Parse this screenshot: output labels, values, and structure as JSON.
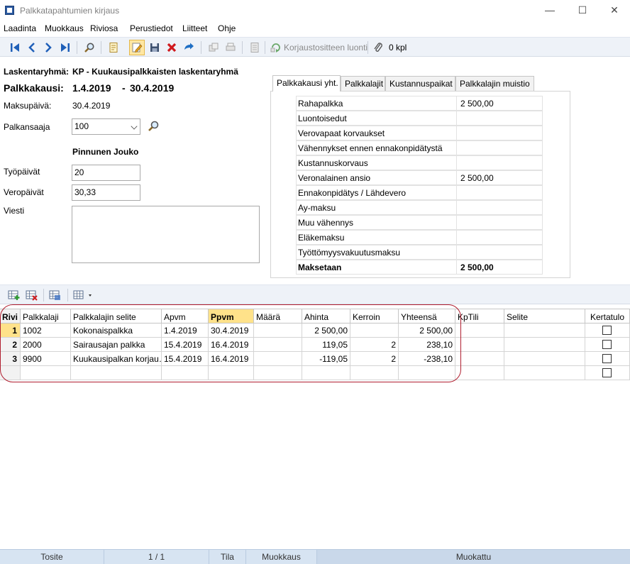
{
  "window": {
    "title": "Palkkatapahtumien kirjaus"
  },
  "menu": [
    "Laadinta",
    "Muokkaus",
    "Riviosa",
    "Perustiedot",
    "Liitteet",
    "Ohje"
  ],
  "toolbar": {
    "correction_label": "Korjaustositteen luonti",
    "count_label": "0 kpl"
  },
  "header": {
    "group_label": "Laskentaryhmä:",
    "group_value": "KP - Kuukausipalkkaisten laskentaryhmä",
    "period_label": "Palkkakausi:",
    "period_start": "1.4.2019",
    "period_sep": "-",
    "period_end": "30.4.2019",
    "paydate_label": "Maksupäivä:",
    "paydate_value": "30.4.2019",
    "employee_label": "Palkansaaja",
    "employee_value": "100",
    "employee_name": "Pinnunen Jouko",
    "workdays_label": "Työpäivät",
    "workdays_value": "20",
    "taxdays_label": "Veropäivät",
    "taxdays_value": "30,33",
    "message_label": "Viesti",
    "message_value": ""
  },
  "tabs": [
    "Palkkakausi yht.",
    "Palkkalajit",
    "Kustannuspaikat",
    "Palkkalajin muistio"
  ],
  "summary": [
    {
      "name": "Rahapalkka",
      "value": "2 500,00"
    },
    {
      "name": "Luontoisedut",
      "value": ""
    },
    {
      "name": "Verovapaat korvaukset",
      "value": ""
    },
    {
      "name": "Vähennykset ennen ennakonpidätystä",
      "value": ""
    },
    {
      "name": "Kustannuskorvaus",
      "value": ""
    },
    {
      "name": "Veronalainen ansio",
      "value": "2 500,00"
    },
    {
      "name": "Ennakonpidätys / Lähdevero",
      "value": ""
    },
    {
      "name": "Ay-maksu",
      "value": ""
    },
    {
      "name": "Muu vähennys",
      "value": ""
    },
    {
      "name": "Eläkemaksu",
      "value": ""
    },
    {
      "name": "Työttömyysvakuutusmaksu",
      "value": ""
    },
    {
      "name": "Maksetaan",
      "value": "2 500,00"
    }
  ],
  "grid": {
    "columns": [
      "Rivi",
      "Palkkalaji",
      "Palkkalajin selite",
      "Apvm",
      "Ppvm",
      "Määrä",
      "Ahinta",
      "Kerroin",
      "Yhteensä",
      "KpTili",
      "Selite",
      "Kertatulo"
    ],
    "rows": [
      {
        "rivi": "1",
        "palkkalaji": "1002",
        "selite": "Kokonaispalkka",
        "apvm": "1.4.2019",
        "ppvm": "30.4.2019",
        "maara": "",
        "ahinta": "2 500,00",
        "kerroin": "",
        "yhteensa": "2 500,00",
        "kptili": "",
        "selite2": ""
      },
      {
        "rivi": "2",
        "palkkalaji": "2000",
        "selite": "Sairausajan palkka",
        "apvm": "15.4.2019",
        "ppvm": "16.4.2019",
        "maara": "",
        "ahinta": "119,05",
        "kerroin": "2",
        "yhteensa": "238,10",
        "kptili": "",
        "selite2": ""
      },
      {
        "rivi": "3",
        "palkkalaji": "9900",
        "selite": "Kuukausipalkan korjau…",
        "apvm": "15.4.2019",
        "ppvm": "16.4.2019",
        "maara": "",
        "ahinta": "-119,05",
        "kerroin": "2",
        "yhteensa": "-238,10",
        "kptili": "",
        "selite2": ""
      }
    ]
  },
  "status": {
    "tosite": "Tosite",
    "page": "1 / 1",
    "tila": "Tila",
    "muokkaus": "Muokkaus",
    "muokattu": "Muokattu"
  },
  "colors": {
    "accent_highlight": "#ffe28a",
    "annotation": "#b01e2f",
    "statusbar": "#d7e4f2"
  }
}
